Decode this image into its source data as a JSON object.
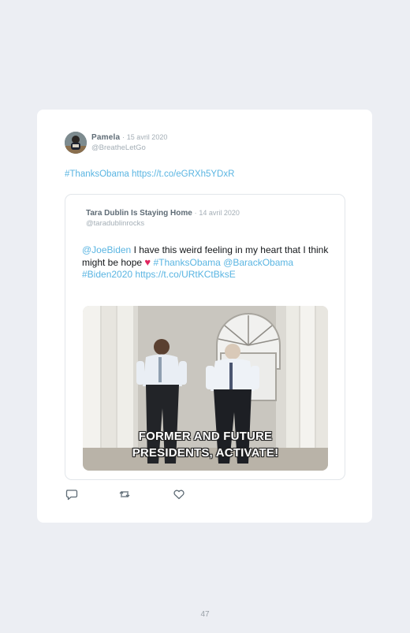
{
  "tweet": {
    "author_name": "Pamela",
    "separator": "·",
    "date": "15 avril 2020",
    "handle": "@BreatheLetGo",
    "hashtag": "#ThanksObama",
    "link": "https://t.co/eGRXh5YDxR"
  },
  "quoted_tweet": {
    "author_name": "Tara Dublin Is Staying Home",
    "separator": "·",
    "date": "14 avril 2020",
    "handle": "@taradublinrocks",
    "mention1": "@JoeBiden",
    "text_part1": " I have this weird feeling in my heart that I think might be hope ",
    "heart": "♥",
    "hashtag1": "#ThanksObama",
    "mention2": "@BarackObama",
    "hashtag2": "#Biden2020",
    "link": "https://t.co/URtKCtBksE",
    "media_caption_line1": "FORMER AND FUTURE",
    "media_caption_line2": "PRESIDENTS, ACTIVATE!"
  },
  "actions": {
    "reply_icon": "reply-icon",
    "retweet_icon": "retweet-icon",
    "like_icon": "like-icon"
  },
  "page": {
    "number": "47"
  },
  "colors": {
    "link": "#5ab5e2",
    "heart": "#e0245e",
    "background": "#eceef3",
    "card": "#ffffff"
  }
}
